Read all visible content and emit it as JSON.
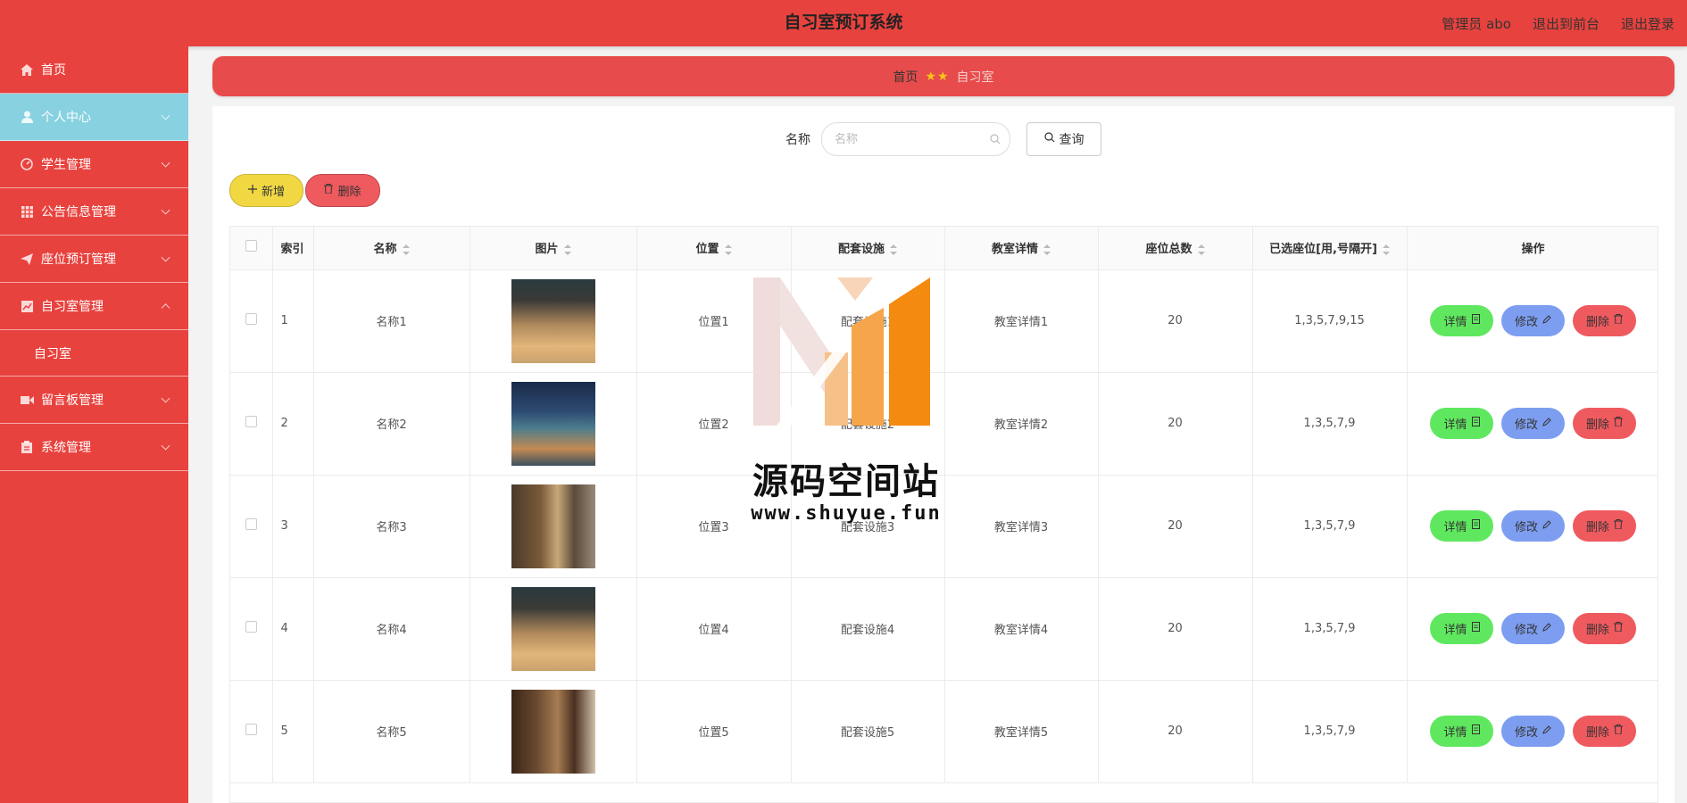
{
  "header": {
    "title": "自习室预订系统",
    "admin": "管理员 abo",
    "exit_front": "退出到前台",
    "logout": "退出登录"
  },
  "sidebar": {
    "items": [
      {
        "label": "首页",
        "icon": "home-icon"
      },
      {
        "label": "个人中心",
        "icon": "user-icon",
        "active": true
      },
      {
        "label": "学生管理",
        "icon": "gauge-icon"
      },
      {
        "label": "公告信息管理",
        "icon": "grid-icon"
      },
      {
        "label": "座位预订管理",
        "icon": "send-icon"
      },
      {
        "label": "自习室管理",
        "icon": "chart-icon",
        "expanded": true
      },
      {
        "label": "自习室",
        "sub": true
      },
      {
        "label": "留言板管理",
        "icon": "video-icon"
      },
      {
        "label": "系统管理",
        "icon": "clipboard-icon"
      }
    ]
  },
  "breadcrumb": {
    "home": "首页",
    "stars": "★★",
    "current": "自习室"
  },
  "search": {
    "label": "名称",
    "placeholder": "名称",
    "query_button": "查询"
  },
  "actions": {
    "add": "新增",
    "delete": "删除"
  },
  "table": {
    "headers": {
      "index": "索引",
      "name": "名称",
      "image": "图片",
      "location": "位置",
      "facilities": "配套设施",
      "details": "教室详情",
      "seats": "座位总数",
      "selected": "已选座位[用,号隔开]",
      "ops": "操作"
    },
    "rows": [
      {
        "index": "1",
        "name": "名称1",
        "location": "位置1",
        "facilities": "配套设施1",
        "details": "教室详情1",
        "seats": "20",
        "selected": "1,3,5,7,9,15",
        "img": "dark"
      },
      {
        "index": "2",
        "name": "名称2",
        "location": "位置2",
        "facilities": "配套设施2",
        "details": "教室详情2",
        "seats": "20",
        "selected": "1,3,5,7,9",
        "img": "blue"
      },
      {
        "index": "3",
        "name": "名称3",
        "location": "位置3",
        "facilities": "配套设施3",
        "details": "教室详情3",
        "seats": "20",
        "selected": "1,3,5,7,9",
        "img": "brown"
      },
      {
        "index": "4",
        "name": "名称4",
        "location": "位置4",
        "facilities": "配套设施4",
        "details": "教室详情4",
        "seats": "20",
        "selected": "1,3,5,7,9",
        "img": "dark"
      },
      {
        "index": "5",
        "name": "名称5",
        "location": "位置5",
        "facilities": "配套设施5",
        "details": "教室详情5",
        "seats": "20",
        "selected": "1,3,5,7,9",
        "img": "wood"
      }
    ],
    "op_labels": {
      "detail": "详情",
      "edit": "修改",
      "remove": "删除"
    }
  },
  "watermark": {
    "text": "源码空间站",
    "url": "www.shuyue.fun"
  },
  "colors": {
    "header": "#e8423e",
    "sidebar": "#e8423e",
    "active_menu": "#87d1e0",
    "add_button": "#f1d843",
    "detail_button": "#5fe85f",
    "edit_button": "#7d9ef0",
    "delete_button": "#ef5a5f"
  }
}
